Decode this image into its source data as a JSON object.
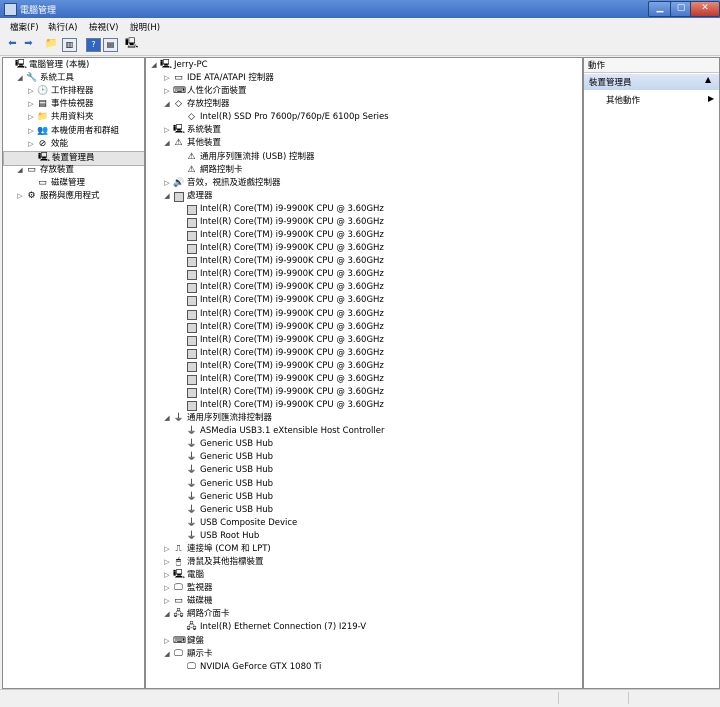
{
  "window": {
    "title": "電腦管理"
  },
  "menu": [
    "檔案(F)",
    "執行(A)",
    "檢視(V)",
    "說明(H)"
  ],
  "left_tree": [
    {
      "label": "電腦管理 (本機)",
      "indent": 0,
      "arrow": "",
      "icon": "computer-icon",
      "glyph": "🖳"
    },
    {
      "label": "系統工具",
      "indent": 1,
      "arrow": "◢",
      "icon": "tools-icon",
      "glyph": "🔧"
    },
    {
      "label": "工作排程器",
      "indent": 2,
      "arrow": "▷",
      "icon": "clock-icon",
      "glyph": "🕒"
    },
    {
      "label": "事件檢視器",
      "indent": 2,
      "arrow": "▷",
      "icon": "event-viewer-icon",
      "glyph": "▤"
    },
    {
      "label": "共用資料夾",
      "indent": 2,
      "arrow": "▷",
      "icon": "shared-folder-icon",
      "glyph": "📁"
    },
    {
      "label": "本機使用者和群組",
      "indent": 2,
      "arrow": "▷",
      "icon": "users-icon",
      "glyph": "👥"
    },
    {
      "label": "效能",
      "indent": 2,
      "arrow": "▷",
      "icon": "performance-icon",
      "glyph": "⊘"
    },
    {
      "label": "裝置管理員",
      "indent": 2,
      "arrow": "",
      "icon": "device-manager-icon",
      "glyph": "🖳",
      "selected": true
    },
    {
      "label": "存放裝置",
      "indent": 1,
      "arrow": "◢",
      "icon": "storage-icon",
      "glyph": "▭"
    },
    {
      "label": "磁碟管理",
      "indent": 2,
      "arrow": "",
      "icon": "disk-icon",
      "glyph": "▭"
    },
    {
      "label": "服務與應用程式",
      "indent": 1,
      "arrow": "▷",
      "icon": "services-icon",
      "glyph": "⚙"
    }
  ],
  "device_tree": [
    {
      "label": "Jerry-PC",
      "indent": 0,
      "arrow": "◢",
      "icon": "computer-icon",
      "glyph": "🖳"
    },
    {
      "label": "IDE ATA/ATAPI 控制器",
      "indent": 1,
      "arrow": "▷",
      "icon": "ide-controller-icon",
      "glyph": "▭"
    },
    {
      "label": "人性化介面裝置",
      "indent": 1,
      "arrow": "▷",
      "icon": "hid-icon",
      "glyph": "⌨"
    },
    {
      "label": "存放控制器",
      "indent": 1,
      "arrow": "◢",
      "icon": "storage-controller-icon",
      "glyph": "◇"
    },
    {
      "label": "Intel(R) SSD Pro 7600p/760p/E 6100p Series",
      "indent": 2,
      "arrow": "",
      "icon": "storage-controller-icon",
      "glyph": "◇"
    },
    {
      "label": "系統裝置",
      "indent": 1,
      "arrow": "▷",
      "icon": "system-device-icon",
      "glyph": "🖳"
    },
    {
      "label": "其他裝置",
      "indent": 1,
      "arrow": "◢",
      "icon": "other-device-icon",
      "glyph": "⚠"
    },
    {
      "label": "通用序列匯流排 (USB) 控制器",
      "indent": 2,
      "arrow": "",
      "icon": "warning-device-icon",
      "glyph": "⚠"
    },
    {
      "label": "網路控制卡",
      "indent": 2,
      "arrow": "",
      "icon": "warning-device-icon",
      "glyph": "⚠"
    },
    {
      "label": "音效，視訊及遊戲控制器",
      "indent": 1,
      "arrow": "▷",
      "icon": "sound-icon",
      "glyph": "🔊"
    },
    {
      "label": "處理器",
      "indent": 1,
      "arrow": "◢",
      "icon": "processor-icon",
      "glyph": "cpu"
    },
    {
      "label": "Intel(R) Core(TM) i9-9900K CPU @ 3.60GHz",
      "indent": 2,
      "arrow": "",
      "icon": "processor-icon",
      "glyph": "cpu"
    },
    {
      "label": "Intel(R) Core(TM) i9-9900K CPU @ 3.60GHz",
      "indent": 2,
      "arrow": "",
      "icon": "processor-icon",
      "glyph": "cpu"
    },
    {
      "label": "Intel(R) Core(TM) i9-9900K CPU @ 3.60GHz",
      "indent": 2,
      "arrow": "",
      "icon": "processor-icon",
      "glyph": "cpu"
    },
    {
      "label": "Intel(R) Core(TM) i9-9900K CPU @ 3.60GHz",
      "indent": 2,
      "arrow": "",
      "icon": "processor-icon",
      "glyph": "cpu"
    },
    {
      "label": "Intel(R) Core(TM) i9-9900K CPU @ 3.60GHz",
      "indent": 2,
      "arrow": "",
      "icon": "processor-icon",
      "glyph": "cpu"
    },
    {
      "label": "Intel(R) Core(TM) i9-9900K CPU @ 3.60GHz",
      "indent": 2,
      "arrow": "",
      "icon": "processor-icon",
      "glyph": "cpu"
    },
    {
      "label": "Intel(R) Core(TM) i9-9900K CPU @ 3.60GHz",
      "indent": 2,
      "arrow": "",
      "icon": "processor-icon",
      "glyph": "cpu"
    },
    {
      "label": "Intel(R) Core(TM) i9-9900K CPU @ 3.60GHz",
      "indent": 2,
      "arrow": "",
      "icon": "processor-icon",
      "glyph": "cpu"
    },
    {
      "label": "Intel(R) Core(TM) i9-9900K CPU @ 3.60GHz",
      "indent": 2,
      "arrow": "",
      "icon": "processor-icon",
      "glyph": "cpu"
    },
    {
      "label": "Intel(R) Core(TM) i9-9900K CPU @ 3.60GHz",
      "indent": 2,
      "arrow": "",
      "icon": "processor-icon",
      "glyph": "cpu"
    },
    {
      "label": "Intel(R) Core(TM) i9-9900K CPU @ 3.60GHz",
      "indent": 2,
      "arrow": "",
      "icon": "processor-icon",
      "glyph": "cpu"
    },
    {
      "label": "Intel(R) Core(TM) i9-9900K CPU @ 3.60GHz",
      "indent": 2,
      "arrow": "",
      "icon": "processor-icon",
      "glyph": "cpu"
    },
    {
      "label": "Intel(R) Core(TM) i9-9900K CPU @ 3.60GHz",
      "indent": 2,
      "arrow": "",
      "icon": "processor-icon",
      "glyph": "cpu"
    },
    {
      "label": "Intel(R) Core(TM) i9-9900K CPU @ 3.60GHz",
      "indent": 2,
      "arrow": "",
      "icon": "processor-icon",
      "glyph": "cpu"
    },
    {
      "label": "Intel(R) Core(TM) i9-9900K CPU @ 3.60GHz",
      "indent": 2,
      "arrow": "",
      "icon": "processor-icon",
      "glyph": "cpu"
    },
    {
      "label": "Intel(R) Core(TM) i9-9900K CPU @ 3.60GHz",
      "indent": 2,
      "arrow": "",
      "icon": "processor-icon",
      "glyph": "cpu"
    },
    {
      "label": "通用序列匯流排控制器",
      "indent": 1,
      "arrow": "◢",
      "icon": "usb-icon",
      "glyph": "usb"
    },
    {
      "label": "ASMedia USB3.1 eXtensible Host Controller",
      "indent": 2,
      "arrow": "",
      "icon": "usb-icon",
      "glyph": "usb"
    },
    {
      "label": "Generic USB Hub",
      "indent": 2,
      "arrow": "",
      "icon": "usb-icon",
      "glyph": "usb"
    },
    {
      "label": "Generic USB Hub",
      "indent": 2,
      "arrow": "",
      "icon": "usb-icon",
      "glyph": "usb"
    },
    {
      "label": "Generic USB Hub",
      "indent": 2,
      "arrow": "",
      "icon": "usb-icon",
      "glyph": "usb"
    },
    {
      "label": "Generic USB Hub",
      "indent": 2,
      "arrow": "",
      "icon": "usb-icon",
      "glyph": "usb"
    },
    {
      "label": "Generic USB Hub",
      "indent": 2,
      "arrow": "",
      "icon": "usb-icon",
      "glyph": "usb"
    },
    {
      "label": "Generic USB Hub",
      "indent": 2,
      "arrow": "",
      "icon": "usb-icon",
      "glyph": "usb"
    },
    {
      "label": "USB Composite Device",
      "indent": 2,
      "arrow": "",
      "icon": "usb-icon",
      "glyph": "usb"
    },
    {
      "label": "USB Root Hub",
      "indent": 2,
      "arrow": "",
      "icon": "usb-icon",
      "glyph": "usb"
    },
    {
      "label": "連接埠 (COM 和 LPT)",
      "indent": 1,
      "arrow": "▷",
      "icon": "port-icon",
      "glyph": "⎍"
    },
    {
      "label": "滑鼠及其他指標裝置",
      "indent": 1,
      "arrow": "▷",
      "icon": "mouse-icon",
      "glyph": "🖱"
    },
    {
      "label": "電腦",
      "indent": 1,
      "arrow": "▷",
      "icon": "computer-icon",
      "glyph": "🖳"
    },
    {
      "label": "監視器",
      "indent": 1,
      "arrow": "▷",
      "icon": "monitor-icon",
      "glyph": "🖵"
    },
    {
      "label": "磁碟機",
      "indent": 1,
      "arrow": "▷",
      "icon": "disk-drive-icon",
      "glyph": "▭"
    },
    {
      "label": "網路介面卡",
      "indent": 1,
      "arrow": "◢",
      "icon": "network-adapter-icon",
      "glyph": "🖧"
    },
    {
      "label": "Intel(R) Ethernet Connection (7) I219-V",
      "indent": 2,
      "arrow": "",
      "icon": "network-adapter-icon",
      "glyph": "🖧"
    },
    {
      "label": "鍵盤",
      "indent": 1,
      "arrow": "▷",
      "icon": "keyboard-icon",
      "glyph": "⌨"
    },
    {
      "label": "顯示卡",
      "indent": 1,
      "arrow": "◢",
      "icon": "display-adapter-icon",
      "glyph": "🖵"
    },
    {
      "label": "NVIDIA GeForce GTX 1080 Ti",
      "indent": 2,
      "arrow": "",
      "icon": "display-adapter-icon",
      "glyph": "🖵"
    }
  ],
  "actions_panel": {
    "header": "動作",
    "section": "裝置管理員",
    "item": "其他動作"
  }
}
